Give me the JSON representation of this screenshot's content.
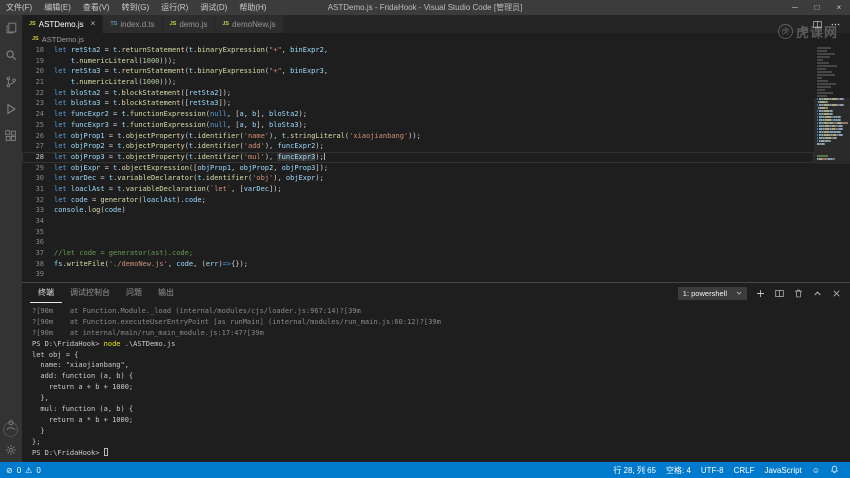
{
  "titlebar": {
    "menus": [
      "文件(F)",
      "编辑(E)",
      "查看(V)",
      "转到(G)",
      "运行(R)",
      "调试(D)",
      "帮助(H)"
    ],
    "title": "ASTDemo.js - FridaHook - Visual Studio Code [管理员]",
    "controls": {
      "minimize": "─",
      "maximize": "□",
      "close": "×"
    }
  },
  "activitybar": {
    "top": [
      "explorer",
      "search",
      "source-control",
      "run-debug",
      "extensions"
    ],
    "bottom": [
      "account",
      "settings"
    ]
  },
  "tabs": [
    {
      "label": "ASTDemo.js",
      "icon": "JS",
      "icon_type": "js",
      "active": true,
      "close": "×"
    },
    {
      "label": "index.d.ts",
      "icon": "TS",
      "icon_type": "ts",
      "active": false
    },
    {
      "label": "demo.js",
      "icon": "JS",
      "icon_type": "js",
      "active": false
    },
    {
      "label": "demoNew.js",
      "icon": "JS",
      "icon_type": "js",
      "active": false
    }
  ],
  "breadcrumb": {
    "icon": "JS",
    "icon_type": "js",
    "file": "ASTDemo.js"
  },
  "editor": {
    "startLine": 18,
    "lines": [
      {
        "t": [
          [
            "kw",
            "let"
          ],
          [
            "pn",
            " "
          ],
          [
            "id",
            "retSta2"
          ],
          [
            "pn",
            " = "
          ],
          [
            "id",
            "t"
          ],
          [
            "pn",
            "."
          ],
          [
            "fn",
            "returnStatement"
          ],
          [
            "pn",
            "("
          ],
          [
            "id",
            "t"
          ],
          [
            "pn",
            "."
          ],
          [
            "fn",
            "binaryExpression"
          ],
          [
            "pn",
            "("
          ],
          [
            "str",
            "\"+\""
          ],
          [
            "pn",
            ", "
          ],
          [
            "id",
            "binExpr2"
          ],
          [
            "pn",
            ","
          ]
        ]
      },
      {
        "t": [
          [
            "pn",
            "    "
          ],
          [
            "id",
            "t"
          ],
          [
            "pn",
            "."
          ],
          [
            "fn",
            "numericLiteral"
          ],
          [
            "pn",
            "("
          ],
          [
            "num",
            "1000"
          ],
          [
            "pn",
            ")));"
          ]
        ]
      },
      {
        "t": [
          [
            "kw",
            "let"
          ],
          [
            "pn",
            " "
          ],
          [
            "id",
            "retSta3"
          ],
          [
            "pn",
            " = "
          ],
          [
            "id",
            "t"
          ],
          [
            "pn",
            "."
          ],
          [
            "fn",
            "returnStatement"
          ],
          [
            "pn",
            "("
          ],
          [
            "id",
            "t"
          ],
          [
            "pn",
            "."
          ],
          [
            "fn",
            "binaryExpression"
          ],
          [
            "pn",
            "("
          ],
          [
            "str",
            "\"+\""
          ],
          [
            "pn",
            ", "
          ],
          [
            "id",
            "binExpr3"
          ],
          [
            "pn",
            ","
          ]
        ]
      },
      {
        "t": [
          [
            "pn",
            "    "
          ],
          [
            "id",
            "t"
          ],
          [
            "pn",
            "."
          ],
          [
            "fn",
            "numericLiteral"
          ],
          [
            "pn",
            "("
          ],
          [
            "num",
            "1000"
          ],
          [
            "pn",
            ")));"
          ]
        ]
      },
      {
        "t": [
          [
            "kw",
            "let"
          ],
          [
            "pn",
            " "
          ],
          [
            "id",
            "bloSta2"
          ],
          [
            "pn",
            " = "
          ],
          [
            "id",
            "t"
          ],
          [
            "pn",
            "."
          ],
          [
            "fn",
            "blockStatement"
          ],
          [
            "pn",
            "(["
          ],
          [
            "id",
            "retSta2"
          ],
          [
            "pn",
            "]);"
          ]
        ]
      },
      {
        "t": [
          [
            "kw",
            "let"
          ],
          [
            "pn",
            " "
          ],
          [
            "id",
            "bloSta3"
          ],
          [
            "pn",
            " = "
          ],
          [
            "id",
            "t"
          ],
          [
            "pn",
            "."
          ],
          [
            "fn",
            "blockStatement"
          ],
          [
            "pn",
            "(["
          ],
          [
            "id",
            "retSta3"
          ],
          [
            "pn",
            "]);"
          ]
        ]
      },
      {
        "t": [
          [
            "kw",
            "let"
          ],
          [
            "pn",
            " "
          ],
          [
            "id",
            "funcExpr2"
          ],
          [
            "pn",
            " = "
          ],
          [
            "id",
            "t"
          ],
          [
            "pn",
            "."
          ],
          [
            "fn",
            "functionExpression"
          ],
          [
            "pn",
            "("
          ],
          [
            "kw",
            "null"
          ],
          [
            "pn",
            ", ["
          ],
          [
            "id",
            "a"
          ],
          [
            "pn",
            ", "
          ],
          [
            "id",
            "b"
          ],
          [
            "pn",
            "], "
          ],
          [
            "id",
            "bloSta2"
          ],
          [
            "pn",
            ");"
          ]
        ]
      },
      {
        "t": [
          [
            "kw",
            "let"
          ],
          [
            "pn",
            " "
          ],
          [
            "id",
            "funcExpr3"
          ],
          [
            "pn",
            " = "
          ],
          [
            "id",
            "t"
          ],
          [
            "pn",
            "."
          ],
          [
            "fn",
            "functionExpression"
          ],
          [
            "pn",
            "("
          ],
          [
            "kw",
            "null"
          ],
          [
            "pn",
            ", ["
          ],
          [
            "id",
            "a"
          ],
          [
            "pn",
            ", "
          ],
          [
            "id",
            "b"
          ],
          [
            "pn",
            "], "
          ],
          [
            "id",
            "bloSta3"
          ],
          [
            "pn",
            ");"
          ]
        ]
      },
      {
        "t": [
          [
            "kw",
            "let"
          ],
          [
            "pn",
            " "
          ],
          [
            "id",
            "objProp1"
          ],
          [
            "pn",
            " = "
          ],
          [
            "id",
            "t"
          ],
          [
            "pn",
            "."
          ],
          [
            "fn",
            "objectProperty"
          ],
          [
            "pn",
            "("
          ],
          [
            "id",
            "t"
          ],
          [
            "pn",
            "."
          ],
          [
            "fn",
            "identifier"
          ],
          [
            "pn",
            "("
          ],
          [
            "str",
            "'name'"
          ],
          [
            "pn",
            "), "
          ],
          [
            "id",
            "t"
          ],
          [
            "pn",
            "."
          ],
          [
            "fn",
            "stringLiteral"
          ],
          [
            "pn",
            "("
          ],
          [
            "str",
            "'xiaojianbang'"
          ],
          [
            "pn",
            "));"
          ]
        ]
      },
      {
        "t": [
          [
            "kw",
            "let"
          ],
          [
            "pn",
            " "
          ],
          [
            "id",
            "objProp2"
          ],
          [
            "pn",
            " = "
          ],
          [
            "id",
            "t"
          ],
          [
            "pn",
            "."
          ],
          [
            "fn",
            "objectProperty"
          ],
          [
            "pn",
            "("
          ],
          [
            "id",
            "t"
          ],
          [
            "pn",
            "."
          ],
          [
            "fn",
            "identifier"
          ],
          [
            "pn",
            "("
          ],
          [
            "str",
            "'add'"
          ],
          [
            "pn",
            "), "
          ],
          [
            "id",
            "funcExpr2"
          ],
          [
            "pn",
            ");"
          ]
        ]
      },
      {
        "cur": true,
        "cursor": true,
        "t": [
          [
            "kw",
            "let"
          ],
          [
            "pn",
            " "
          ],
          [
            "id",
            "objProp3"
          ],
          [
            "pn",
            " = "
          ],
          [
            "id",
            "t"
          ],
          [
            "pn",
            "."
          ],
          [
            "fn",
            "objectProperty"
          ],
          [
            "pn",
            "("
          ],
          [
            "id",
            "t"
          ],
          [
            "pn",
            "."
          ],
          [
            "fn",
            "identifier"
          ],
          [
            "pn",
            "("
          ],
          [
            "str",
            "'mul'"
          ],
          [
            "pn",
            "), "
          ],
          [
            "id occ",
            "funcExpr3"
          ],
          [
            "pn",
            ");"
          ]
        ]
      },
      {
        "t": [
          [
            "kw",
            "let"
          ],
          [
            "pn",
            " "
          ],
          [
            "id",
            "objExpr"
          ],
          [
            "pn",
            " = "
          ],
          [
            "id",
            "t"
          ],
          [
            "pn",
            "."
          ],
          [
            "fn",
            "objectExpression"
          ],
          [
            "pn",
            "(["
          ],
          [
            "id",
            "objProp1"
          ],
          [
            "pn",
            ", "
          ],
          [
            "id",
            "objProp2"
          ],
          [
            "pn",
            ", "
          ],
          [
            "id",
            "objProp3"
          ],
          [
            "pn",
            "]);"
          ]
        ]
      },
      {
        "t": [
          [
            "kw",
            "let"
          ],
          [
            "pn",
            " "
          ],
          [
            "id",
            "varDec"
          ],
          [
            "pn",
            " = "
          ],
          [
            "id",
            "t"
          ],
          [
            "pn",
            "."
          ],
          [
            "fn",
            "variableDeclarator"
          ],
          [
            "pn",
            "("
          ],
          [
            "id",
            "t"
          ],
          [
            "pn",
            "."
          ],
          [
            "fn",
            "identifier"
          ],
          [
            "pn",
            "("
          ],
          [
            "str",
            "'obj'"
          ],
          [
            "pn",
            "), "
          ],
          [
            "id",
            "objExpr"
          ],
          [
            "pn",
            ");"
          ]
        ]
      },
      {
        "t": [
          [
            "kw",
            "let"
          ],
          [
            "pn",
            " "
          ],
          [
            "id",
            "loaclAst"
          ],
          [
            "pn",
            " = "
          ],
          [
            "id",
            "t"
          ],
          [
            "pn",
            "."
          ],
          [
            "fn",
            "variableDeclaration"
          ],
          [
            "pn",
            "("
          ],
          [
            "str",
            "`let`"
          ],
          [
            "pn",
            ", ["
          ],
          [
            "id",
            "varDec"
          ],
          [
            "pn",
            "]);"
          ]
        ]
      },
      {
        "t": [
          [
            "kw",
            "let"
          ],
          [
            "pn",
            " "
          ],
          [
            "id",
            "code"
          ],
          [
            "pn",
            " = "
          ],
          [
            "fn",
            "generator"
          ],
          [
            "pn",
            "("
          ],
          [
            "id",
            "loaclAst"
          ],
          [
            "pn",
            ")."
          ],
          [
            "id",
            "code"
          ],
          [
            "pn",
            ";"
          ]
        ]
      },
      {
        "t": [
          [
            "id",
            "console"
          ],
          [
            "pn",
            "."
          ],
          [
            "fn",
            "log"
          ],
          [
            "pn",
            "("
          ],
          [
            "id",
            "code"
          ],
          [
            "pn",
            ")"
          ]
        ]
      },
      {
        "t": []
      },
      {
        "t": []
      },
      {
        "t": []
      },
      {
        "t": [
          [
            "cm",
            "//let code = generator(ast).code;"
          ]
        ]
      },
      {
        "t": [
          [
            "id",
            "fs"
          ],
          [
            "pn",
            "."
          ],
          [
            "fn",
            "writeFile"
          ],
          [
            "pn",
            "("
          ],
          [
            "str",
            "'./demoNew.js'"
          ],
          [
            "pn",
            ", "
          ],
          [
            "id",
            "code"
          ],
          [
            "pn",
            ", ("
          ],
          [
            "id",
            "err"
          ],
          [
            "pn",
            ")"
          ],
          [
            "kw",
            "=>"
          ],
          [
            "pn",
            "{});"
          ]
        ]
      },
      {
        "t": []
      }
    ]
  },
  "panel": {
    "tabs": [
      {
        "label": "终端",
        "active": true
      },
      {
        "label": "调试控制台",
        "active": false
      },
      {
        "label": "问题",
        "active": false
      },
      {
        "label": "输出",
        "active": false
      }
    ],
    "shell": "1: powershell"
  },
  "terminal": {
    "lines": [
      {
        "p": [
          [
            "dim",
            "?[90m    at Function.Module._load (internal/modules/cjs/loader.js:967:14)?[39m"
          ]
        ]
      },
      {
        "p": [
          [
            "dim",
            "?[90m    at Function.executeUserEntryPoint [as runMain] (internal/modules/run_main.js:60:12)?[39m"
          ]
        ]
      },
      {
        "p": [
          [
            "dim",
            "?[90m    at internal/main/run_main_module.js:17:47?[39m"
          ]
        ]
      },
      {
        "p": [
          [
            "def",
            "PS D:\\FridaHook> "
          ],
          [
            "cmd",
            "node"
          ],
          [
            "def",
            " .\\ASTDemo.js"
          ]
        ]
      },
      {
        "p": [
          [
            "def",
            "let obj = {"
          ]
        ]
      },
      {
        "p": [
          [
            "def",
            "  name: \"xiaojianbang\","
          ]
        ]
      },
      {
        "p": [
          [
            "def",
            "  add: function (a, b) {"
          ]
        ]
      },
      {
        "p": [
          [
            "def",
            "    return a + b + 1000;"
          ]
        ]
      },
      {
        "p": [
          [
            "def",
            "  },"
          ]
        ]
      },
      {
        "p": [
          [
            "def",
            "  mul: function (a, b) {"
          ]
        ]
      },
      {
        "p": [
          [
            "def",
            "    return a * b + 1000;"
          ]
        ]
      },
      {
        "p": [
          [
            "def",
            "  }"
          ]
        ]
      },
      {
        "p": [
          [
            "def",
            "};"
          ]
        ]
      },
      {
        "p": [
          [
            "def",
            "PS D:\\FridaHook> "
          ]
        ],
        "cursor": true
      }
    ]
  },
  "statusbar": {
    "errors": "0",
    "warnings": "0",
    "items": [
      "行 28, 列 65",
      "空格: 4",
      "UTF-8",
      "CRLF",
      "JavaScript"
    ]
  },
  "watermark": {
    "badge": "虎",
    "text": "虎课网"
  }
}
